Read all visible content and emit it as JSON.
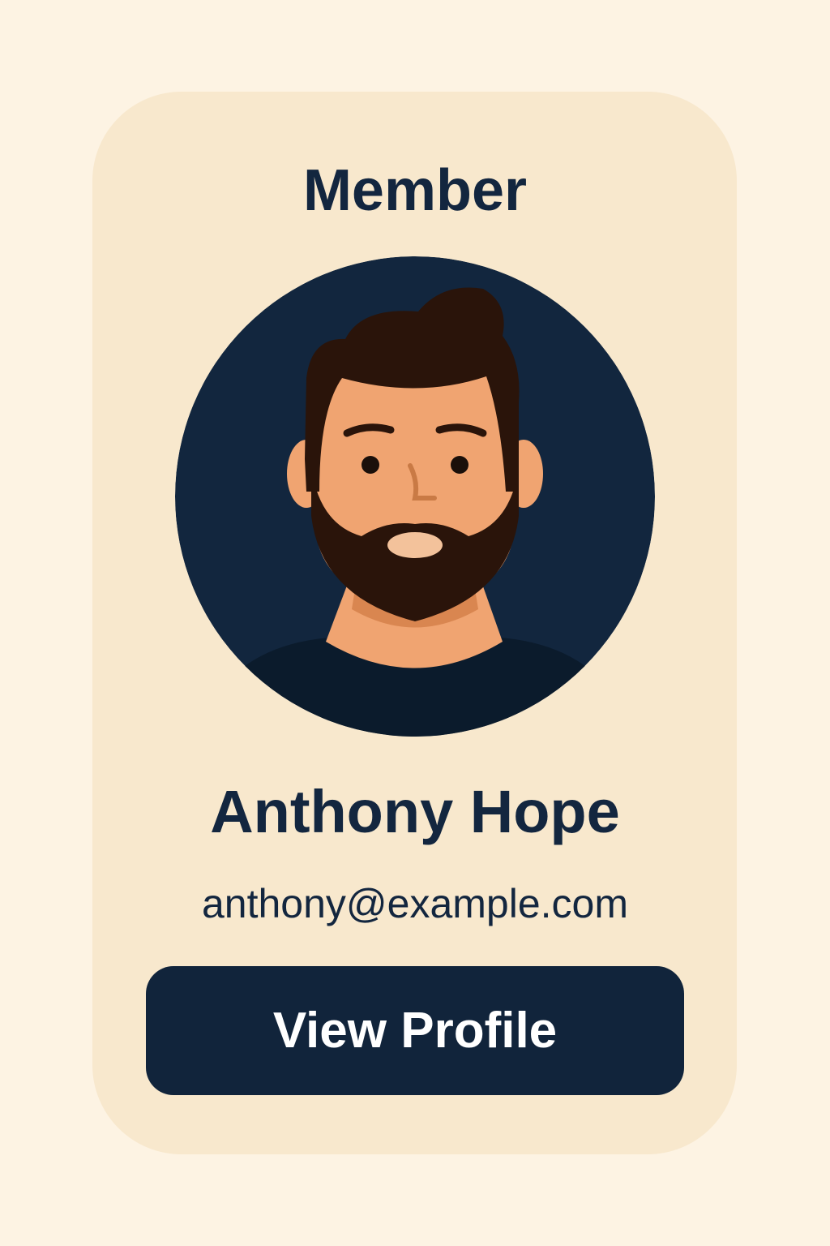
{
  "card": {
    "role_label": "Member",
    "name": "Anthony Hope",
    "email": "anthony@example.com",
    "action_label": "View Profile",
    "avatar_icon": "bearded-man-avatar-icon"
  },
  "colors": {
    "page_background": "#fdf3e3",
    "card_background": "#f8e8cd",
    "accent_navy": "#13263f",
    "button_background": "#11243b",
    "button_text": "#ffffff"
  }
}
